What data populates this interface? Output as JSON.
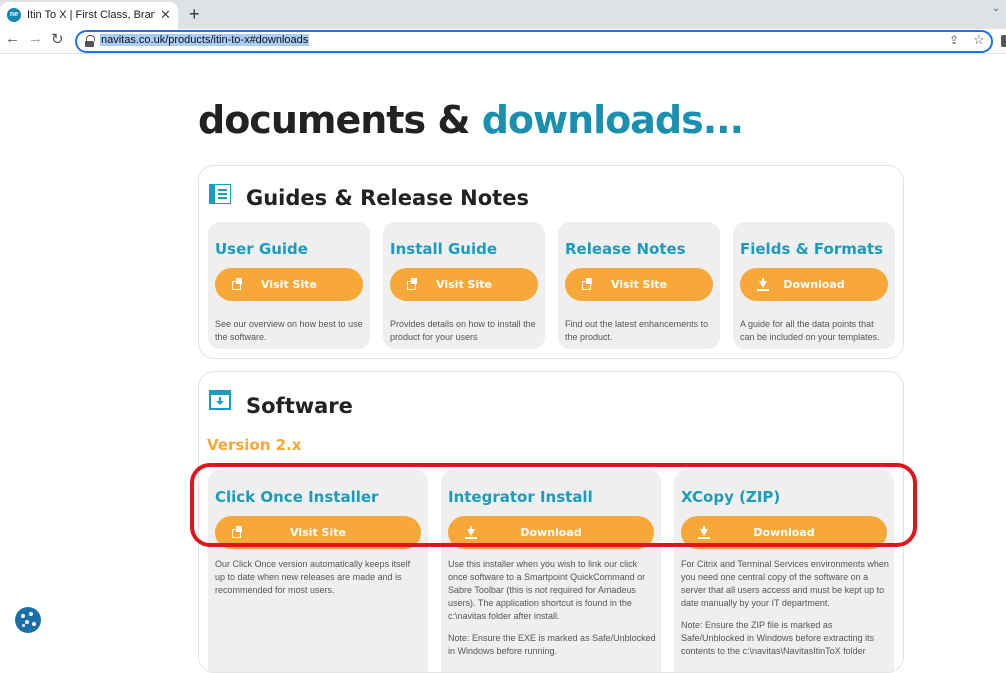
{
  "browser": {
    "tab_title": "Itin To X | First Class, Branded Itin",
    "favicon_text": "ne",
    "url": "navitas.co.uk/products/itin-to-x#downloads"
  },
  "page": {
    "title_part1": "documents & ",
    "title_part2": "downloads..."
  },
  "guides": {
    "heading": "Guides & Release Notes",
    "cards": [
      {
        "title": "User Guide",
        "button": "Visit Site",
        "icon": "external-link-icon",
        "desc": "See our overview on how best to use the software."
      },
      {
        "title": "Install Guide",
        "button": "Visit Site",
        "icon": "external-link-icon",
        "desc": "Provides details on how to install the product for your users"
      },
      {
        "title": "Release Notes",
        "button": "Visit Site",
        "icon": "external-link-icon",
        "desc": "Find out the latest enhancements to the product."
      },
      {
        "title": "Fields & Formats",
        "button": "Download",
        "icon": "download-icon",
        "desc": "A guide for all the data points that can be included on your templates."
      }
    ]
  },
  "software": {
    "heading": "Software",
    "version": "Version 2.x",
    "cards": [
      {
        "title": "Click Once Installer",
        "button": "Visit Site",
        "icon": "external-link-icon",
        "desc": "Our Click Once version automatically keeps itself up to date when new releases are made and is recommended for most users."
      },
      {
        "title": "Integrator Install",
        "button": "Download",
        "icon": "download-icon",
        "desc": "Use this installer when you wish to link our click once software to a Smartpoint QuickCommand or Sabre Toolbar (this is not required for Amadeus users). The application shortcut is found in the c:\\navitas folder after install.",
        "note": "Note: Ensure the EXE is marked as Safe/Unblocked in Windows before running."
      },
      {
        "title": "XCopy (ZIP)",
        "button": "Download",
        "icon": "download-icon",
        "desc": "For Citrix and Terminal Services environments when you need one central copy of the software on a server that all users access and must be kept up to date manually by your IT department.",
        "note": "Note: Ensure the ZIP file is marked as Safe/Unblocked in Windows before extracting its contents to the c:\\navitas\\NavitasItinToX folder"
      }
    ]
  },
  "colors": {
    "accent_teal": "#1a8fb0",
    "button_orange": "#f7a839",
    "highlight_red": "#e0151b"
  }
}
